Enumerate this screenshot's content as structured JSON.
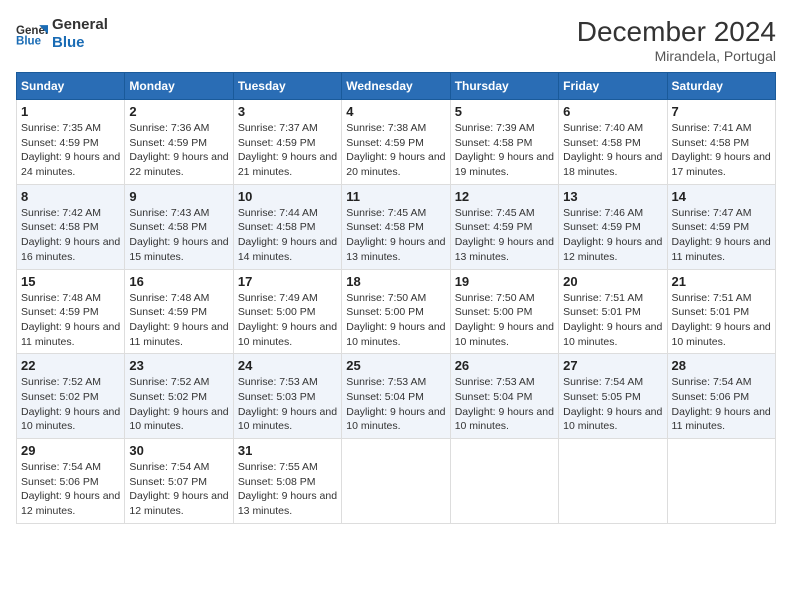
{
  "logo": {
    "text_general": "General",
    "text_blue": "Blue"
  },
  "title": "December 2024",
  "subtitle": "Mirandela, Portugal",
  "days_of_week": [
    "Sunday",
    "Monday",
    "Tuesday",
    "Wednesday",
    "Thursday",
    "Friday",
    "Saturday"
  ],
  "weeks": [
    [
      {
        "day": "1",
        "sunrise": "7:35 AM",
        "sunset": "4:59 PM",
        "daylight": "9 hours and 24 minutes."
      },
      {
        "day": "2",
        "sunrise": "7:36 AM",
        "sunset": "4:59 PM",
        "daylight": "9 hours and 22 minutes."
      },
      {
        "day": "3",
        "sunrise": "7:37 AM",
        "sunset": "4:59 PM",
        "daylight": "9 hours and 21 minutes."
      },
      {
        "day": "4",
        "sunrise": "7:38 AM",
        "sunset": "4:59 PM",
        "daylight": "9 hours and 20 minutes."
      },
      {
        "day": "5",
        "sunrise": "7:39 AM",
        "sunset": "4:58 PM",
        "daylight": "9 hours and 19 minutes."
      },
      {
        "day": "6",
        "sunrise": "7:40 AM",
        "sunset": "4:58 PM",
        "daylight": "9 hours and 18 minutes."
      },
      {
        "day": "7",
        "sunrise": "7:41 AM",
        "sunset": "4:58 PM",
        "daylight": "9 hours and 17 minutes."
      }
    ],
    [
      {
        "day": "8",
        "sunrise": "7:42 AM",
        "sunset": "4:58 PM",
        "daylight": "9 hours and 16 minutes."
      },
      {
        "day": "9",
        "sunrise": "7:43 AM",
        "sunset": "4:58 PM",
        "daylight": "9 hours and 15 minutes."
      },
      {
        "day": "10",
        "sunrise": "7:44 AM",
        "sunset": "4:58 PM",
        "daylight": "9 hours and 14 minutes."
      },
      {
        "day": "11",
        "sunrise": "7:45 AM",
        "sunset": "4:58 PM",
        "daylight": "9 hours and 13 minutes."
      },
      {
        "day": "12",
        "sunrise": "7:45 AM",
        "sunset": "4:59 PM",
        "daylight": "9 hours and 13 minutes."
      },
      {
        "day": "13",
        "sunrise": "7:46 AM",
        "sunset": "4:59 PM",
        "daylight": "9 hours and 12 minutes."
      },
      {
        "day": "14",
        "sunrise": "7:47 AM",
        "sunset": "4:59 PM",
        "daylight": "9 hours and 11 minutes."
      }
    ],
    [
      {
        "day": "15",
        "sunrise": "7:48 AM",
        "sunset": "4:59 PM",
        "daylight": "9 hours and 11 minutes."
      },
      {
        "day": "16",
        "sunrise": "7:48 AM",
        "sunset": "4:59 PM",
        "daylight": "9 hours and 11 minutes."
      },
      {
        "day": "17",
        "sunrise": "7:49 AM",
        "sunset": "5:00 PM",
        "daylight": "9 hours and 10 minutes."
      },
      {
        "day": "18",
        "sunrise": "7:50 AM",
        "sunset": "5:00 PM",
        "daylight": "9 hours and 10 minutes."
      },
      {
        "day": "19",
        "sunrise": "7:50 AM",
        "sunset": "5:00 PM",
        "daylight": "9 hours and 10 minutes."
      },
      {
        "day": "20",
        "sunrise": "7:51 AM",
        "sunset": "5:01 PM",
        "daylight": "9 hours and 10 minutes."
      },
      {
        "day": "21",
        "sunrise": "7:51 AM",
        "sunset": "5:01 PM",
        "daylight": "9 hours and 10 minutes."
      }
    ],
    [
      {
        "day": "22",
        "sunrise": "7:52 AM",
        "sunset": "5:02 PM",
        "daylight": "9 hours and 10 minutes."
      },
      {
        "day": "23",
        "sunrise": "7:52 AM",
        "sunset": "5:02 PM",
        "daylight": "9 hours and 10 minutes."
      },
      {
        "day": "24",
        "sunrise": "7:53 AM",
        "sunset": "5:03 PM",
        "daylight": "9 hours and 10 minutes."
      },
      {
        "day": "25",
        "sunrise": "7:53 AM",
        "sunset": "5:04 PM",
        "daylight": "9 hours and 10 minutes."
      },
      {
        "day": "26",
        "sunrise": "7:53 AM",
        "sunset": "5:04 PM",
        "daylight": "9 hours and 10 minutes."
      },
      {
        "day": "27",
        "sunrise": "7:54 AM",
        "sunset": "5:05 PM",
        "daylight": "9 hours and 10 minutes."
      },
      {
        "day": "28",
        "sunrise": "7:54 AM",
        "sunset": "5:06 PM",
        "daylight": "9 hours and 11 minutes."
      }
    ],
    [
      {
        "day": "29",
        "sunrise": "7:54 AM",
        "sunset": "5:06 PM",
        "daylight": "9 hours and 12 minutes."
      },
      {
        "day": "30",
        "sunrise": "7:54 AM",
        "sunset": "5:07 PM",
        "daylight": "9 hours and 12 minutes."
      },
      {
        "day": "31",
        "sunrise": "7:55 AM",
        "sunset": "5:08 PM",
        "daylight": "9 hours and 13 minutes."
      },
      null,
      null,
      null,
      null
    ]
  ],
  "labels": {
    "sunrise": "Sunrise:",
    "sunset": "Sunset:",
    "daylight": "Daylight:"
  }
}
